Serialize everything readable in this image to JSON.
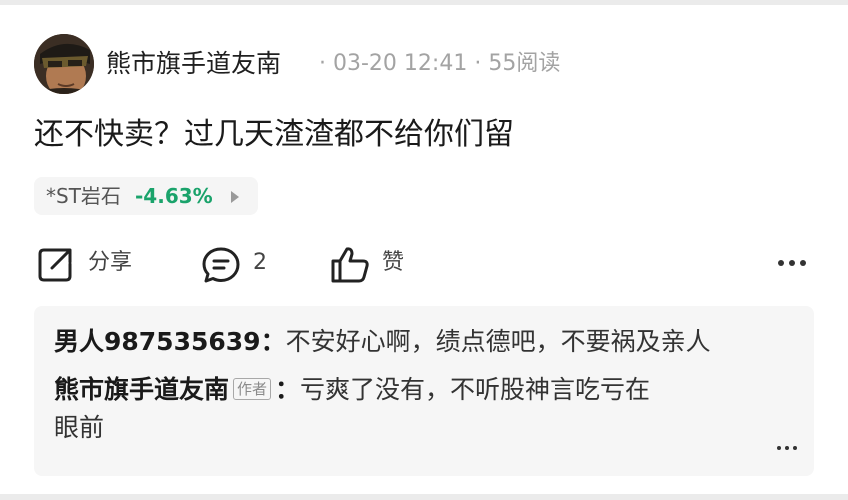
{
  "post": {
    "author": "熊市旗手道友南",
    "date": "03-20 12:41",
    "separator": "·",
    "reads": "55阅读",
    "text": "还不快卖？过几天渣渣都不给你们留"
  },
  "stock": {
    "name": "*ST岩石",
    "change": "-4.63%",
    "change_color": "#1aa36b"
  },
  "actions": {
    "share_label": "分享",
    "comment_count": "2",
    "like_label": "赞"
  },
  "comments": [
    {
      "user": "男人987535639",
      "colon": "：",
      "text": "不安好心啊，绩点德吧，不要祸及亲人"
    },
    {
      "user": "熊市旗手道友南",
      "badge": "作者",
      "colon": "：",
      "text": "亏爽了没有，不听股神言吃亏在",
      "text_cont": "眼前"
    }
  ],
  "icons": {
    "share": "share-icon",
    "comment": "comment-icon",
    "like": "thumbs-up-icon",
    "more": "more-icon"
  }
}
